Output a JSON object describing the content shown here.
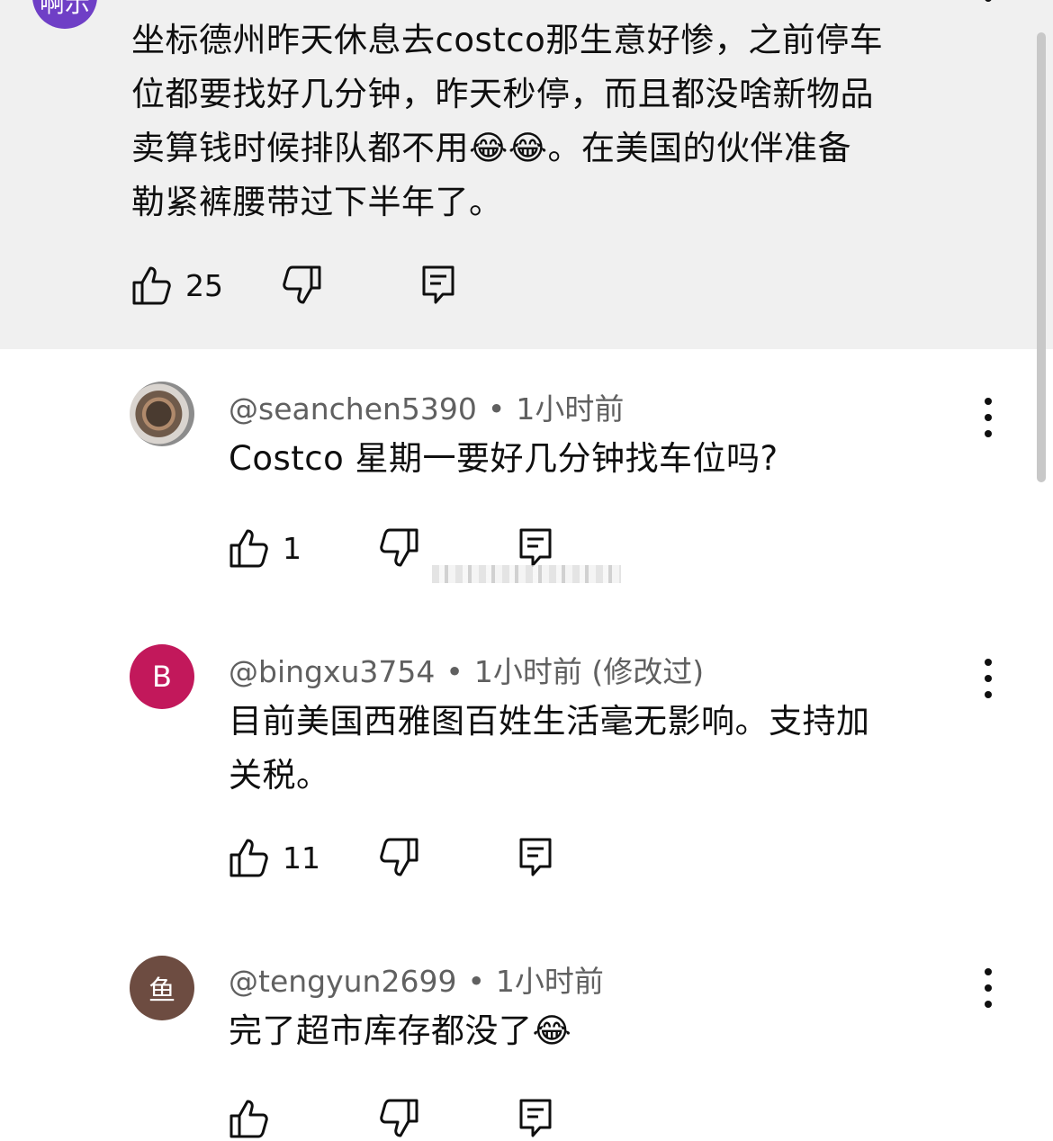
{
  "comments": [
    {
      "avatar_text": "啊示",
      "text": "坐标德州昨天休息去costco那生意好惨，之前停车\n位都要找好几分钟，昨天秒停，而且都没啥新物品\n卖算钱时候排队都不用😂😂。在美国的伙伴准备\n勒紧裤腰带过下半年了。",
      "likes": "25"
    },
    {
      "author": "@seanchen5390",
      "time": "1小时前",
      "text": "Costco 星期一要好几分钟找车位吗?",
      "likes": "1"
    },
    {
      "avatar_text": "B",
      "avatar_color": "#c2185b",
      "author": "@bingxu3754",
      "time": "1小时前 (修改过)",
      "text": "目前美国西雅图百姓生活毫无影响。支持加\n关税。",
      "likes": "11"
    },
    {
      "avatar_text": "鱼",
      "avatar_color": "#6d4c41",
      "author": "@tengyun2699",
      "time": "1小时前",
      "text": "完了超市库存都没了😂",
      "likes": ""
    }
  ]
}
